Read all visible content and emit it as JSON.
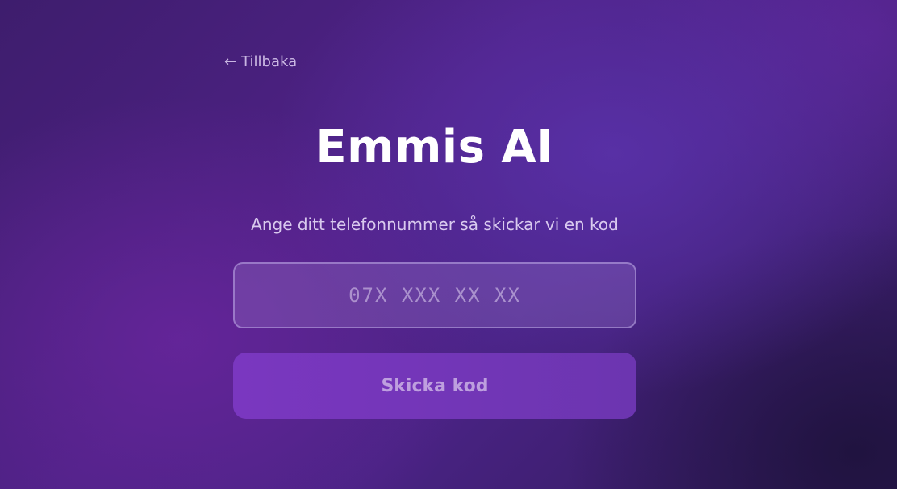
{
  "nav": {
    "back_arrow": "←",
    "back_label": "Tillbaka"
  },
  "header": {
    "title": "Emmis AI",
    "subtitle": "Ange ditt telefonnummer så skickar vi en kod"
  },
  "form": {
    "phone_placeholder": "07X XXX XX XX",
    "phone_value": "",
    "submit_label": "Skicka kod"
  }
}
